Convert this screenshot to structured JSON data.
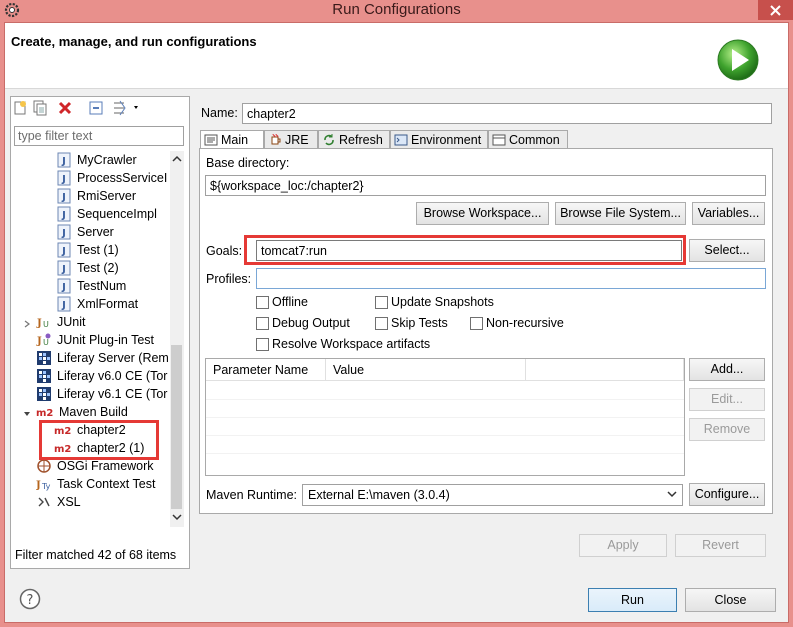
{
  "window": {
    "title": "Run Configurations"
  },
  "header": {
    "text": "Create, manage, and run configurations"
  },
  "left": {
    "filter_placeholder": "type filter text",
    "tree": [
      {
        "label": "MyCrawler",
        "icon": "java-class-icon"
      },
      {
        "label": "ProcessServiceI",
        "icon": "java-class-icon"
      },
      {
        "label": "RmiServer",
        "icon": "java-class-icon"
      },
      {
        "label": "SequenceImpl",
        "icon": "java-class-icon"
      },
      {
        "label": "Server",
        "icon": "java-class-icon"
      },
      {
        "label": "Test (1)",
        "icon": "java-class-icon"
      },
      {
        "label": "Test (2)",
        "icon": "java-class-icon"
      },
      {
        "label": "TestNum",
        "icon": "java-class-icon"
      },
      {
        "label": "XmlFormat",
        "icon": "java-class-icon"
      },
      {
        "label": "JUnit",
        "icon": "junit-icon"
      },
      {
        "label": "JUnit Plug-in Test",
        "icon": "junit-plugin-icon"
      },
      {
        "label": "Liferay Server (Rem",
        "icon": "liferay-icon"
      },
      {
        "label": "Liferay v6.0 CE (Tor",
        "icon": "liferay-icon"
      },
      {
        "label": "Liferay v6.1 CE (Tor",
        "icon": "liferay-icon"
      },
      {
        "label": "Maven Build",
        "icon": "maven-m2-icon"
      },
      {
        "label": "chapter2",
        "icon": "maven-m2-icon"
      },
      {
        "label": "chapter2 (1)",
        "icon": "maven-m2-icon"
      },
      {
        "label": "OSGi Framework",
        "icon": "osgi-icon"
      },
      {
        "label": "Task Context Test",
        "icon": "task-context-icon"
      },
      {
        "label": "XSL",
        "icon": "xsl-icon"
      }
    ],
    "status": "Filter matched 42 of 68 items"
  },
  "main": {
    "name_label": "Name:",
    "name_value": "chapter2",
    "tabs": [
      "Main",
      "JRE",
      "Refresh",
      "Environment",
      "Common"
    ],
    "base_dir_label": "Base directory:",
    "base_dir_value": "${workspace_loc:/chapter2}",
    "browse_workspace": "Browse Workspace...",
    "browse_fs": "Browse File System...",
    "variables": "Variables...",
    "goals_label": "Goals:",
    "goals_value": "tomcat7:run",
    "select": "Select...",
    "profiles_label": "Profiles:",
    "profiles_value": "",
    "checkboxes": {
      "offline": "Offline",
      "update_snapshots": "Update Snapshots",
      "debug_output": "Debug Output",
      "skip_tests": "Skip Tests",
      "non_recursive": "Non-recursive",
      "resolve_workspace": "Resolve Workspace artifacts"
    },
    "params_headers": [
      "Parameter Name",
      "Value"
    ],
    "add": "Add...",
    "edit": "Edit...",
    "remove": "Remove",
    "runtime_label": "Maven Runtime:",
    "runtime_value": "External E:\\maven (3.0.4)",
    "configure": "Configure...",
    "apply": "Apply",
    "revert": "Revert"
  },
  "footer": {
    "run": "Run",
    "close": "Close"
  }
}
